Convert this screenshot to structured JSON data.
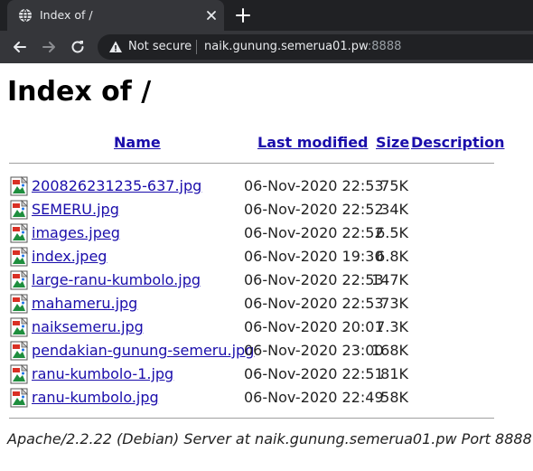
{
  "browser": {
    "tab": {
      "title": "Index of /",
      "favicon": "globe-icon",
      "close_icon": "close-icon"
    },
    "new_tab_icon": "plus-icon",
    "toolbar": {
      "back_icon": "arrow-left-icon",
      "forward_icon": "arrow-right-icon",
      "reload_icon": "reload-icon",
      "security_icon": "warning-triangle-icon",
      "security_label": "Not secure",
      "url_host": "naik.gunung.semerua01.pw",
      "url_port": ":8888"
    },
    "colors": {
      "tabstrip": "#202124",
      "toolbar": "#35363a",
      "omnibox": "#202124",
      "text": "#e8eaed"
    }
  },
  "page": {
    "title": "Index of /",
    "columns": {
      "name": "Name",
      "last_modified": "Last modified",
      "size": "Size",
      "description": "Description"
    },
    "files": [
      {
        "name": "200826231235-637.jpg",
        "modified": "06-Nov-2020 22:53",
        "size": "75K"
      },
      {
        "name": "SEMERU.jpg",
        "modified": "06-Nov-2020 22:52",
        "size": "34K"
      },
      {
        "name": "images.jpeg",
        "modified": "06-Nov-2020 22:52",
        "size": "6.5K"
      },
      {
        "name": "index.jpeg",
        "modified": "06-Nov-2020 19:30",
        "size": "6.8K"
      },
      {
        "name": "large-ranu-kumbolo.jpg",
        "modified": "06-Nov-2020 22:53",
        "size": "147K"
      },
      {
        "name": "mahameru.jpg",
        "modified": "06-Nov-2020 22:53",
        "size": "73K"
      },
      {
        "name": "naiksemeru.jpg",
        "modified": "06-Nov-2020 20:01",
        "size": "7.3K"
      },
      {
        "name": "pendakian-gunung-semeru.jpg",
        "modified": "06-Nov-2020 23:00",
        "size": "168K"
      },
      {
        "name": "ranu-kumbolo-1.jpg",
        "modified": "06-Nov-2020 22:51",
        "size": "81K"
      },
      {
        "name": "ranu-kumbolo.jpg",
        "modified": "06-Nov-2020 22:49",
        "size": "58K"
      }
    ],
    "file_icon": "image-file-icon",
    "footer": "Apache/2.2.22 (Debian) Server at naik.gunung.semerua01.pw Port 8888",
    "colors": {
      "link": "#1a0dab",
      "rule": "#a0a0a0"
    }
  }
}
